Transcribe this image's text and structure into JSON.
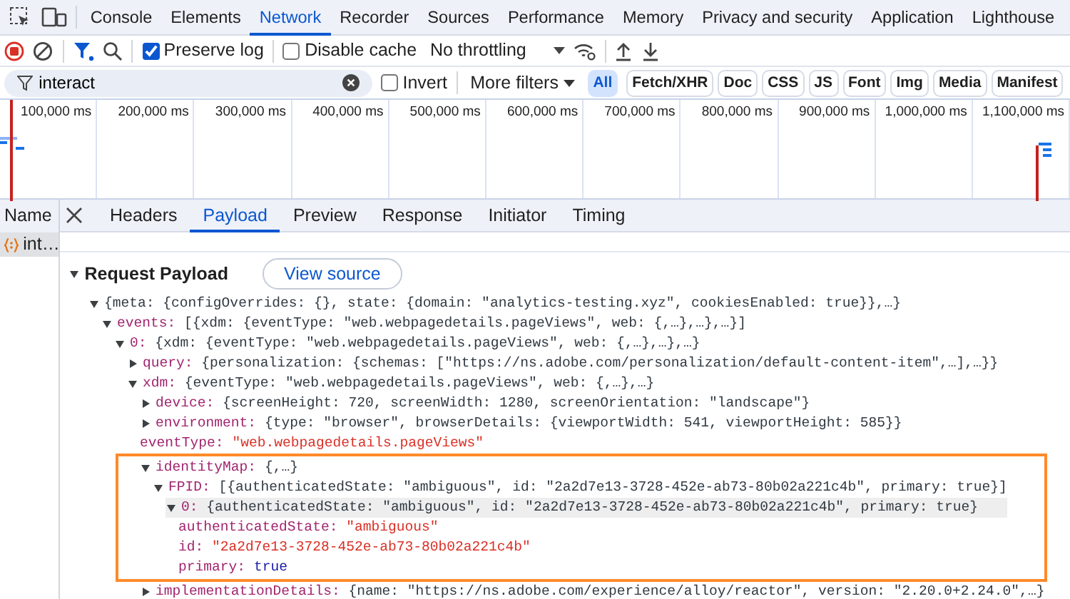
{
  "panel_tabs": [
    {
      "label": "Console",
      "selected": false
    },
    {
      "label": "Elements",
      "selected": false
    },
    {
      "label": "Network",
      "selected": true
    },
    {
      "label": "Recorder",
      "selected": false
    },
    {
      "label": "Sources",
      "selected": false
    },
    {
      "label": "Performance",
      "selected": false
    },
    {
      "label": "Memory",
      "selected": false
    },
    {
      "label": "Privacy and security",
      "selected": false
    },
    {
      "label": "Application",
      "selected": false
    },
    {
      "label": "Lighthouse",
      "selected": false
    }
  ],
  "toolbar": {
    "filter_on": true,
    "preserve_log": {
      "label": "Preserve log",
      "checked": true
    },
    "disable_cache": {
      "label": "Disable cache",
      "checked": false
    },
    "throttling": "No throttling"
  },
  "filter": {
    "value": "interact",
    "invert": {
      "label": "Invert",
      "checked": false
    },
    "more_filters": "More filters",
    "types": [
      {
        "label": "All",
        "selected": true
      },
      {
        "label": "Fetch/XHR",
        "selected": false
      },
      {
        "label": "Doc",
        "selected": false
      },
      {
        "label": "CSS",
        "selected": false
      },
      {
        "label": "JS",
        "selected": false
      },
      {
        "label": "Font",
        "selected": false
      },
      {
        "label": "Img",
        "selected": false
      },
      {
        "label": "Media",
        "selected": false
      },
      {
        "label": "Manifest",
        "selected": false
      }
    ]
  },
  "timeline": {
    "ticks": [
      "100,000 ms",
      "200,000 ms",
      "300,000 ms",
      "400,000 ms",
      "500,000 ms",
      "600,000 ms",
      "700,000 ms",
      "800,000 ms",
      "900,000 ms",
      "1,000,000 ms",
      "1,100,000 ms"
    ]
  },
  "requests": {
    "header": "Name",
    "rows": [
      {
        "name": "int…",
        "selected": true
      }
    ]
  },
  "detail_tabs": [
    {
      "label": "Headers",
      "selected": false
    },
    {
      "label": "Payload",
      "selected": true
    },
    {
      "label": "Preview",
      "selected": false
    },
    {
      "label": "Response",
      "selected": false
    },
    {
      "label": "Initiator",
      "selected": false
    },
    {
      "label": "Timing",
      "selected": false
    }
  ],
  "payload": {
    "title": "Request Payload",
    "expanded": true,
    "view_source": "View source",
    "tree": [
      {
        "kind": "object",
        "value": "{meta: {configOverrides: {}, state: {domain: \"analytics-testing.xyz\", cookiesEnabled: true}},…}",
        "expanded": true,
        "children": [
          {
            "key": "events:",
            "kind": "object",
            "value": "[{xdm: {eventType: \"web.webpagedetails.pageViews\", web: {,…},…},…}]",
            "expanded": true,
            "children": [
              {
                "key": "0:",
                "kind": "object",
                "value": "{xdm: {eventType: \"web.webpagedetails.pageViews\", web: {,…},…},…}",
                "expanded": true,
                "children": [
                  {
                    "key": "query:",
                    "kind": "object",
                    "value": "{personalization: {schemas: [\"https://ns.adobe.com/personalization/default-content-item\",…],…}}",
                    "expanded": false
                  },
                  {
                    "key": "xdm:",
                    "kind": "object",
                    "value": "{eventType: \"web.webpagedetails.pageViews\", web: {,…},…}",
                    "expanded": true,
                    "children": [
                      {
                        "key": "device:",
                        "kind": "object",
                        "value": "{screenHeight: 720, screenWidth: 1280, screenOrientation: \"landscape\"}",
                        "expanded": false
                      },
                      {
                        "key": "environment:",
                        "kind": "object",
                        "value": "{type: \"browser\", browserDetails: {viewportWidth: 541, viewportHeight: 585}}",
                        "expanded": false
                      },
                      {
                        "key": "eventType:",
                        "kind": "string",
                        "value": "\"web.webpagedetails.pageViews\""
                      },
                      {
                        "key": "identityMap:",
                        "kind": "object",
                        "value": "{,…}",
                        "expanded": true,
                        "highlighted": true,
                        "children": [
                          {
                            "key": "FPID:",
                            "kind": "object",
                            "value": "[{authenticatedState: \"ambiguous\", id: \"2a2d7e13-3728-452e-ab73-80b02a221c4b\", primary: true}]",
                            "expanded": true,
                            "children": [
                              {
                                "key": "0:",
                                "kind": "object",
                                "value": "{authenticatedState: \"ambiguous\", id: \"2a2d7e13-3728-452e-ab73-80b02a221c4b\", primary: true}",
                                "expanded": true,
                                "hovered": true,
                                "children": [
                                  {
                                    "key": "authenticatedState:",
                                    "kind": "string",
                                    "value": "\"ambiguous\""
                                  },
                                  {
                                    "key": "id:",
                                    "kind": "string",
                                    "value": "\"2a2d7e13-3728-452e-ab73-80b02a221c4b\""
                                  },
                                  {
                                    "key": "primary:",
                                    "kind": "boolean",
                                    "value": "true"
                                  }
                                ]
                              }
                            ]
                          }
                        ]
                      },
                      {
                        "key": "implementationDetails:",
                        "kind": "object",
                        "value": "{name: \"https://ns.adobe.com/experience/alloy/reactor\", version: \"2.20.0+2.24.0\",…}",
                        "expanded": false
                      }
                    ]
                  }
                ]
              }
            ]
          }
        ]
      }
    ]
  }
}
